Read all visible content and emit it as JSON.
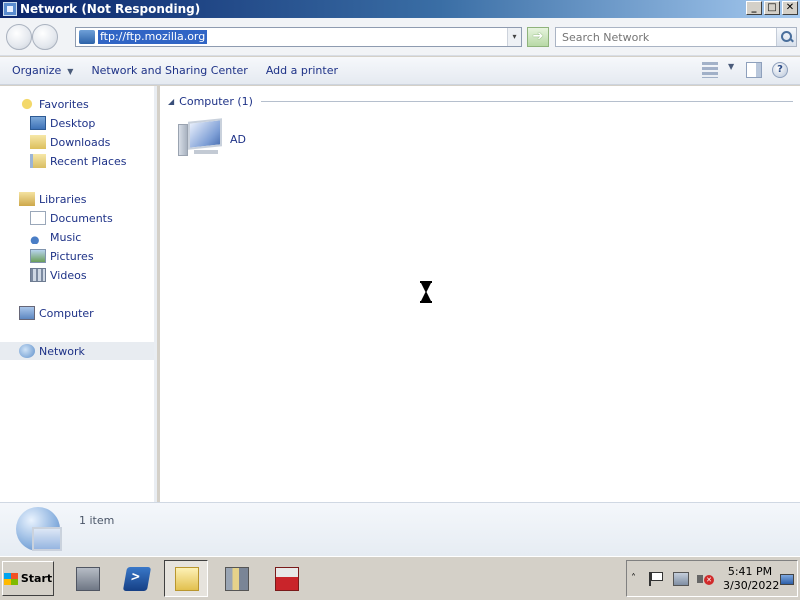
{
  "window": {
    "title": "Network (Not Responding)",
    "buttons": {
      "minimize": "_",
      "maximize": "□",
      "close": "✕"
    }
  },
  "address_bar": {
    "url": "ftp://ftp.mozilla.org",
    "dropdown_glyph": "▾",
    "go_glyph": "➔",
    "search_placeholder": "Search Network"
  },
  "command_bar": {
    "organize": "Organize",
    "organize_caret": "▼",
    "network_sharing": "Network and Sharing Center",
    "add_printer": "Add a printer",
    "view_caret": "▼",
    "help_glyph": "?"
  },
  "nav_pane": {
    "favorites": "Favorites",
    "desktop": "Desktop",
    "downloads": "Downloads",
    "recent_places": "Recent Places",
    "libraries": "Libraries",
    "documents": "Documents",
    "music": "Music",
    "pictures": "Pictures",
    "videos": "Videos",
    "computer": "Computer",
    "network": "Network"
  },
  "content": {
    "group_header": "Computer (1)",
    "group_toggle": "◢",
    "items": [
      {
        "label": "AD",
        "icon": "computer-icon"
      }
    ]
  },
  "details": {
    "item_count": "1 item"
  },
  "taskbar": {
    "start_label": "Start",
    "tray_chevron": "˄",
    "time": "5:41 PM",
    "date": "3/30/2022"
  }
}
